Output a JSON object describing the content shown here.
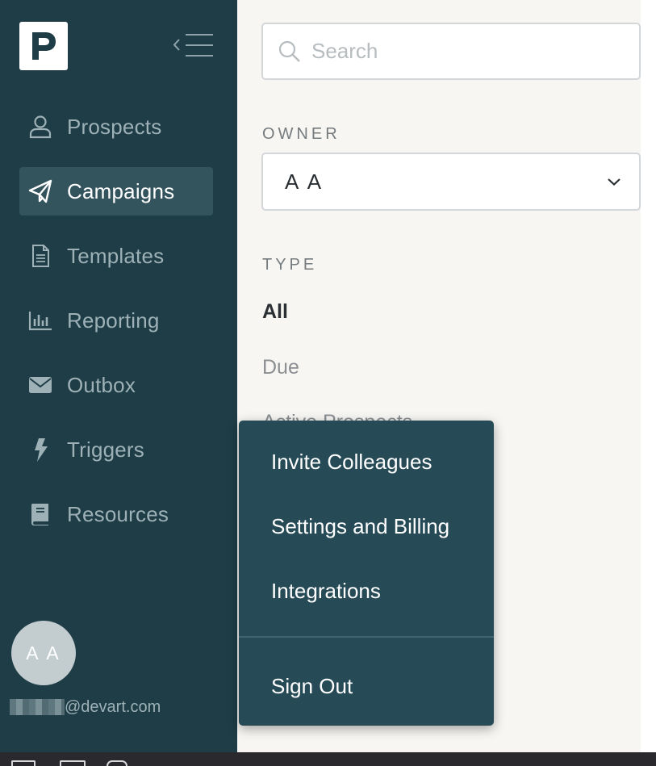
{
  "app": {
    "logo_letter": "P",
    "accent": "#1e3d47"
  },
  "sidebar": {
    "items": [
      {
        "label": "Prospects",
        "icon": "person-icon",
        "active": false
      },
      {
        "label": "Campaigns",
        "icon": "paper-plane-icon",
        "active": true
      },
      {
        "label": "Templates",
        "icon": "document-icon",
        "active": false
      },
      {
        "label": "Reporting",
        "icon": "bar-chart-icon",
        "active": false
      },
      {
        "label": "Outbox",
        "icon": "envelope-icon",
        "active": false
      },
      {
        "label": "Triggers",
        "icon": "lightning-icon",
        "active": false
      },
      {
        "label": "Resources",
        "icon": "book-icon",
        "active": false
      }
    ],
    "user": {
      "initials": "A A",
      "email_domain": "@devart.com"
    }
  },
  "filters": {
    "search": {
      "placeholder": "Search"
    },
    "owner": {
      "label": "OWNER",
      "value": "A A"
    },
    "type": {
      "label": "TYPE",
      "options": [
        "All",
        "Due",
        "Active Prospects"
      ],
      "selected": "All"
    }
  },
  "user_menu": {
    "items": [
      "Invite Colleagues",
      "Settings and Billing",
      "Integrations"
    ],
    "sign_out": "Sign Out"
  }
}
